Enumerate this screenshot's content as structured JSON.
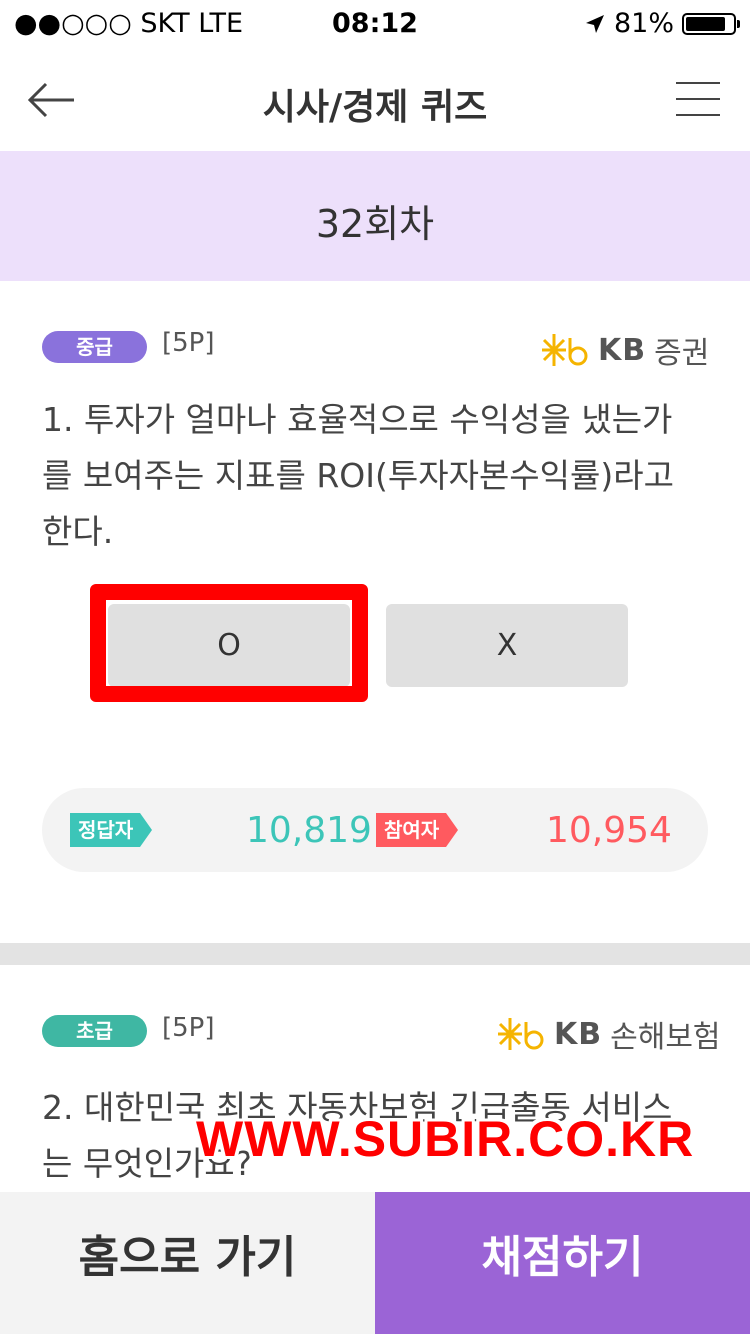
{
  "status_bar": {
    "carrier": "●●○○○ SKT   LTE",
    "time": "08:12",
    "battery": "81%"
  },
  "nav": {
    "title": "시사/경제 퀴즈"
  },
  "round": {
    "label": "32회차"
  },
  "questions": [
    {
      "level": "중급",
      "points": "[5P]",
      "sponsor": {
        "kb": "KB",
        "name": "증권"
      },
      "lines": [
        "1. 투자가 얼마나 효율적으로 수익성을 냈는가",
        "를 보여주는 지표를 ROI(투자자본수익률)라고",
        "한다."
      ],
      "answers": [
        "O",
        "X"
      ],
      "stats": {
        "correct_label": "정답자",
        "correct_count": "10,819",
        "participants_label": "참여자",
        "participants_count": "10,954"
      }
    },
    {
      "level": "초급",
      "points": "[5P]",
      "sponsor": {
        "kb": "KB",
        "name": "손해보험"
      },
      "lines": [
        "2. 대한민국 최초 자동차보험 긴급출동 서비스",
        "는 무엇인가요?"
      ]
    }
  ],
  "watermark": "WWW.SUBIR.CO.KR",
  "bottom": {
    "home_label": "홈으로 가기",
    "grade_label": "채점하기"
  },
  "colors": {
    "accent": "#9b64d6",
    "band": "#ede0fb",
    "highlight": "#ff0000",
    "correct": "#3cc5b8",
    "participants": "#ff5a5f",
    "kb_star": "#f5b400"
  }
}
